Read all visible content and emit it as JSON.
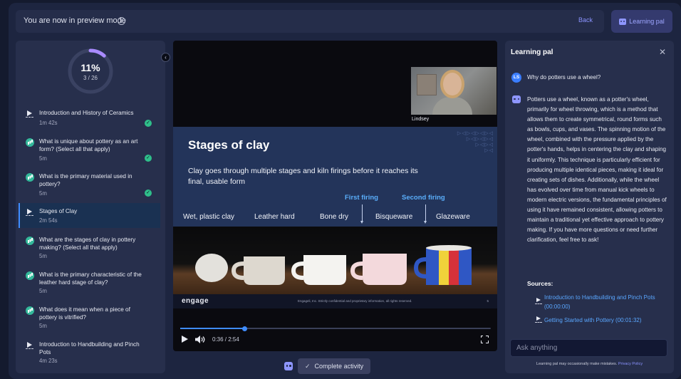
{
  "topbar": {
    "preview_text": "You are now in preview mode",
    "back_label": "Back",
    "learning_pal_label": "Learning pal"
  },
  "progress": {
    "percent_label": "11%",
    "fraction_label": "3 / 26",
    "fraction_complete": 0.115
  },
  "lessons": [
    {
      "type": "video",
      "title": "Introduction and History of Ceramics",
      "duration": "1m 42s",
      "completed": true
    },
    {
      "type": "quiz",
      "title": "What is unique about pottery as an art form? (Select all that apply)",
      "duration": "5m",
      "completed": true
    },
    {
      "type": "quiz",
      "title": "What is the primary material used in pottery?",
      "duration": "5m",
      "completed": true
    },
    {
      "type": "video",
      "title": "Stages of Clay",
      "duration": "2m 54s",
      "completed": false,
      "active": true
    },
    {
      "type": "quiz",
      "title": "What are the stages of clay in pottery making? (Select all that apply)",
      "duration": "5m",
      "completed": false
    },
    {
      "type": "quiz",
      "title": "What is the primary characteristic of the leather hard stage of clay?",
      "duration": "5m",
      "completed": false
    },
    {
      "type": "quiz",
      "title": "What does it mean when a piece of pottery is vitrified?",
      "duration": "5m",
      "completed": false
    },
    {
      "type": "video",
      "title": "Introduction to Handbuilding and Pinch Pots",
      "duration": "4m 23s",
      "completed": false
    }
  ],
  "video": {
    "webcam_label": "Lindsey",
    "slide_title": "Stages of clay",
    "slide_subtitle": "Clay goes through multiple stages and kiln firings before it reaches its final, usable form",
    "first_firing": "First firing",
    "second_firing": "Second firing",
    "stages": [
      "Wet, plastic clay",
      "Leather hard",
      "Bone dry",
      "Bisqueware",
      "Glazeware"
    ],
    "brand": "engage",
    "legal": "Engageli, Inc. Strictly confidential and proprietary information, all rights reserved.",
    "page_number": "5",
    "time": "0:36 / 2:54",
    "played_fraction": 0.207
  },
  "complete_activity_label": "Complete activity",
  "panel": {
    "title": "Learning pal",
    "user_initials": "LS",
    "question": "Why do potters use a wheel?",
    "answer": "Potters use a wheel, known as a potter's wheel, primarily for wheel throwing, which is a method that allows them to create symmetrical, round forms such as bowls, cups, and vases. The spinning motion of the wheel, combined with the pressure applied by the potter's hands, helps in centering the clay and shaping it uniformly. This technique is particularly efficient for producing multiple identical pieces, making it ideal for creating sets of dishes. Additionally, while the wheel has evolved over time from manual kick wheels to modern electric versions, the fundamental principles of using it have remained consistent, allowing potters to maintain a traditional yet effective approach to pottery making. If you have more questions or need further clarification, feel free to ask!",
    "sources_heading": "Sources:",
    "sources": [
      "Introduction to Handbuilding and Pinch Pots (00:00:00)",
      "Getting Started with Pottery (00:01:32)"
    ],
    "ask_placeholder": "Ask anything",
    "disclaimer": "Learning pal may occasionally make mistakes.",
    "privacy_policy": "Privacy Policy"
  },
  "colors": {
    "accent": "#3f8cff",
    "success": "#2fbf8a",
    "quiz": "#33b89a",
    "link": "#5aa7ff",
    "robot": "#8e96ff"
  }
}
